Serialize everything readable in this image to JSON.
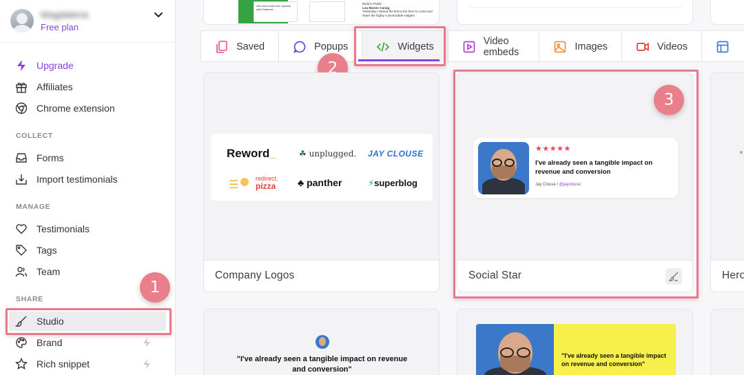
{
  "profile": {
    "name": "Magdalena",
    "plan": "Free plan"
  },
  "sidebar": {
    "top_items": [
      {
        "label": "Upgrade",
        "icon": "bolt-icon"
      },
      {
        "label": "Affiliates",
        "icon": "gift-icon"
      },
      {
        "label": "Chrome extension",
        "icon": "chrome-icon"
      }
    ],
    "sections": {
      "collect": "COLLECT",
      "manage": "MANAGE",
      "share": "SHARE"
    },
    "collect_items": [
      {
        "label": "Forms",
        "icon": "inbox-icon"
      },
      {
        "label": "Import testimonials",
        "icon": "import-icon"
      }
    ],
    "manage_items": [
      {
        "label": "Testimonials",
        "icon": "heart-icon"
      },
      {
        "label": "Tags",
        "icon": "tag-icon"
      },
      {
        "label": "Team",
        "icon": "users-icon"
      }
    ],
    "share_items": [
      {
        "label": "Studio",
        "icon": "brush-icon"
      },
      {
        "label": "Brand",
        "icon": "palette-icon"
      },
      {
        "label": "Rich snippet",
        "icon": "star-icon"
      }
    ]
  },
  "tabs": [
    {
      "label": "Saved",
      "icon": "copy-icon",
      "color": "#e54d97"
    },
    {
      "label": "Popups",
      "icon": "chat-icon",
      "color": "#5a4fcf"
    },
    {
      "label": "Widgets",
      "icon": "code-icon",
      "color": "#3fa63a"
    },
    {
      "label": "Video embeds",
      "icon": "play-icon",
      "color": "#b23fd1"
    },
    {
      "label": "Images",
      "icon": "image-icon",
      "color": "#f0913a"
    },
    {
      "label": "Videos",
      "icon": "video-icon",
      "color": "#e53d3d"
    }
  ],
  "cards": {
    "company_logos": {
      "title": "Company Logos",
      "logos": [
        "Reword",
        "unplugged.",
        "JAY CLOUSE",
        "redirect.",
        "pizza",
        "panther",
        "superblog"
      ]
    },
    "social_star": {
      "title": "Social Star",
      "stars": "★★★★★",
      "quote": "I've already seen a tangible impact on revenue and conversion",
      "author": "Jay Clouse",
      "handle": "@jayclouse"
    },
    "partial_right": {
      "title": "Hero"
    },
    "bottom_left": {
      "quote": "\"I've already seen a tangible impact on revenue and conversion\""
    },
    "bottom_right": {
      "quote": "\"I've already seen a tangible impact on revenue and conversion\""
    }
  },
  "top_preview": {
    "text_a": "Get more work from Upwork with Featured",
    "text_b": "Build in Public",
    "text_c": "Lou Marvin Caraig",
    "text_d": "Yesterday I shared the link to the form to come and share the highly customizable widgets"
  },
  "annotations": [
    "1",
    "2",
    "3"
  ],
  "colors": {
    "accent": "#8b3fe3",
    "highlight": "#e77a8a",
    "widgets_underline": "#8b3fe3"
  }
}
